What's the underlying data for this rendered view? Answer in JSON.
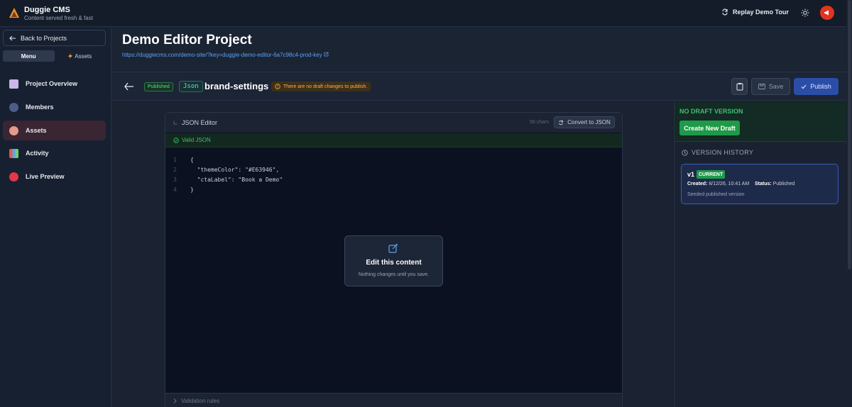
{
  "app": {
    "title": "Duggie CMS",
    "subtitle": "Content served fresh & fast"
  },
  "topbar": {
    "tour_label": "Replay Demo Tour"
  },
  "sidebar": {
    "back_label": "Back to Projects",
    "tabs": [
      {
        "label": "Menu"
      },
      {
        "label": "Assets"
      }
    ],
    "items": [
      {
        "label": "Project Overview",
        "icon": "document-icon"
      },
      {
        "label": "Members",
        "icon": "people-icon"
      },
      {
        "label": "Assets",
        "icon": "palette-icon"
      },
      {
        "label": "Activity",
        "icon": "bar-chart-icon"
      },
      {
        "label": "Live Preview",
        "icon": "red-circle-icon"
      }
    ]
  },
  "project": {
    "title": "Demo Editor Project",
    "link": "https://duggiecms.com/demo-site/?key=duggie-demo-editor-6a7c98c4-prod-key"
  },
  "toolbar": {
    "status_badge": "Published",
    "type_badge": "Json",
    "doc_name": "brand-settings",
    "warning": "There are no draft changes to publish.",
    "save_label": "Save",
    "publish_label": "Publish"
  },
  "editor": {
    "title": "JSON Editor",
    "chars": "58 chars",
    "convert_label": "Convert to JSON",
    "valid_label": "Valid JSON",
    "lines": [
      {
        "num": "1",
        "text": "{"
      },
      {
        "num": "2",
        "text": "  \"themeColor\": \"#E63946\","
      },
      {
        "num": "3",
        "text": "  \"ctaLabel\": \"Book a Demo\""
      },
      {
        "num": "4",
        "text": "}"
      }
    ],
    "overlay_title": "Edit this content",
    "overlay_sub": "Nothing changes until you save.",
    "rules_label": "Validation rules"
  },
  "draft": {
    "label": "NO DRAFT VERSION",
    "create_label": "Create New Draft"
  },
  "history": {
    "label": "VERSION HISTORY",
    "versions": [
      {
        "version": "v1",
        "badge": "CURRENT",
        "created_label": "Created:",
        "created": "8/12/26, 10:41 AM",
        "status_label": "Status:",
        "status": "Published",
        "note": "Seeded published version"
      }
    ]
  },
  "colors": {
    "accent": "#2a4ea8",
    "success": "#1e9a48",
    "warning": "#f2b64c",
    "brand": "#e3341f"
  }
}
